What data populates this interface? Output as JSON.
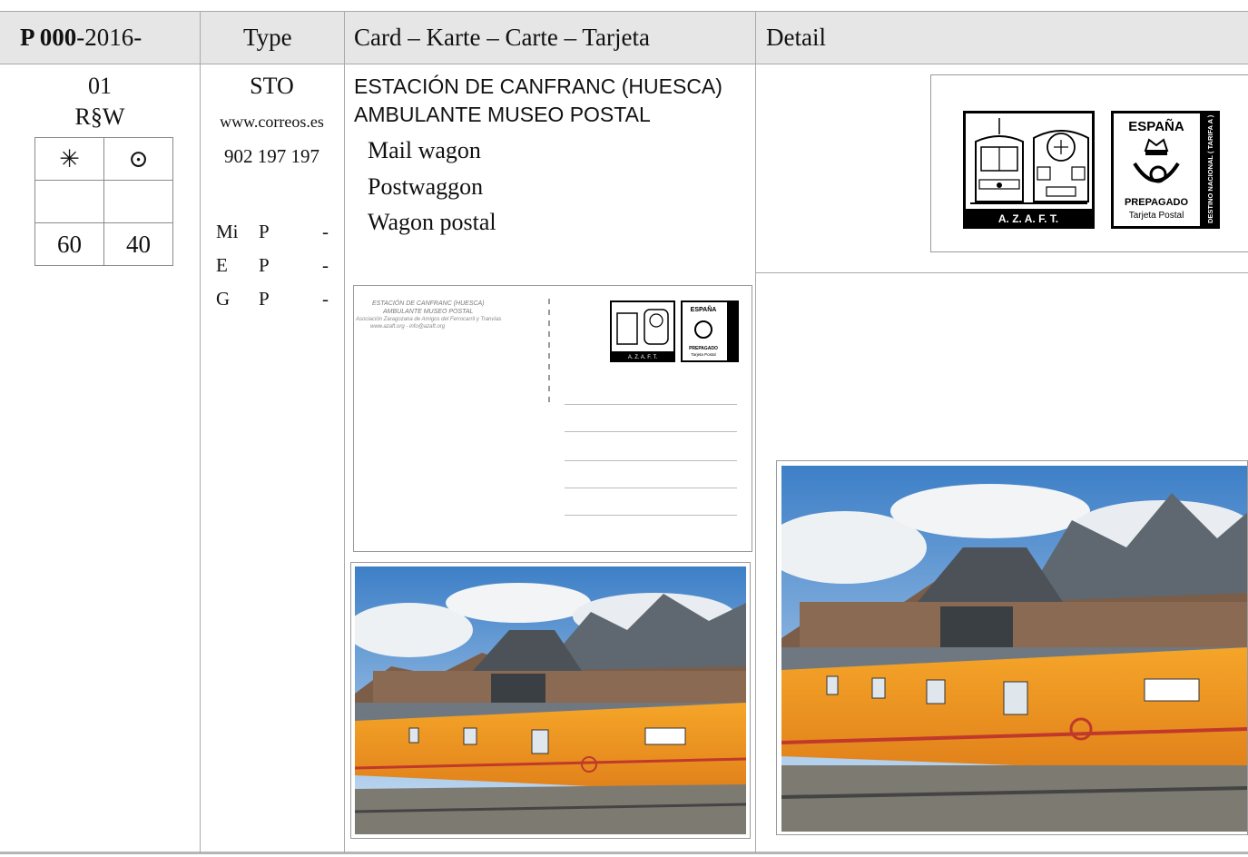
{
  "header": {
    "id_bold": "P 000",
    "id_rest": "-2016-",
    "type": "Type",
    "card": "Card – Karte – Carte – Tarjeta",
    "detail": "Detail"
  },
  "row": {
    "number": "01",
    "code": "R§W",
    "mint_symbol": "✳",
    "used_symbol": "⊙",
    "empty_mint": "",
    "empty_used": "",
    "price_mint": "60",
    "price_used": "40",
    "type": "STO",
    "website": "www.correos.es",
    "phone": "902 197 197",
    "catalogs": [
      {
        "name": "Mi",
        "code": "P",
        "value": "-"
      },
      {
        "name": "E",
        "code": "P",
        "value": "-"
      },
      {
        "name": "G",
        "code": "P",
        "value": "-"
      }
    ],
    "title_line1": "ESTACIÓN DE CANFRANC (HUESCA)",
    "title_line2": "AMBULANTE MUSEO POSTAL",
    "names": [
      "Mail wagon",
      "Postwaggon",
      "Wagon postal"
    ]
  },
  "stamp": {
    "azaft": "A. Z. A. F. T.",
    "country": "ESPAÑA",
    "prepaid": "PREPAGADO",
    "card_type": "Tarjeta Postal",
    "side_text": "DESTINO NACIONAL ( TARIFA A )"
  },
  "card_back": {
    "line1": "ESTACIÓN DE CANFRANC (HUESCA)",
    "line2": "AMBULANTE MUSEO POSTAL",
    "line3": "Asociación Zaragozana de Amigos del Ferrocarril y Tranvías",
    "line4": "www.azaft.org  -  info@azaft.org"
  },
  "colors": {
    "header_bg": "#e6e6e6",
    "wagon_orange": "#f29a1e",
    "stamp_red": "#c0392b"
  }
}
